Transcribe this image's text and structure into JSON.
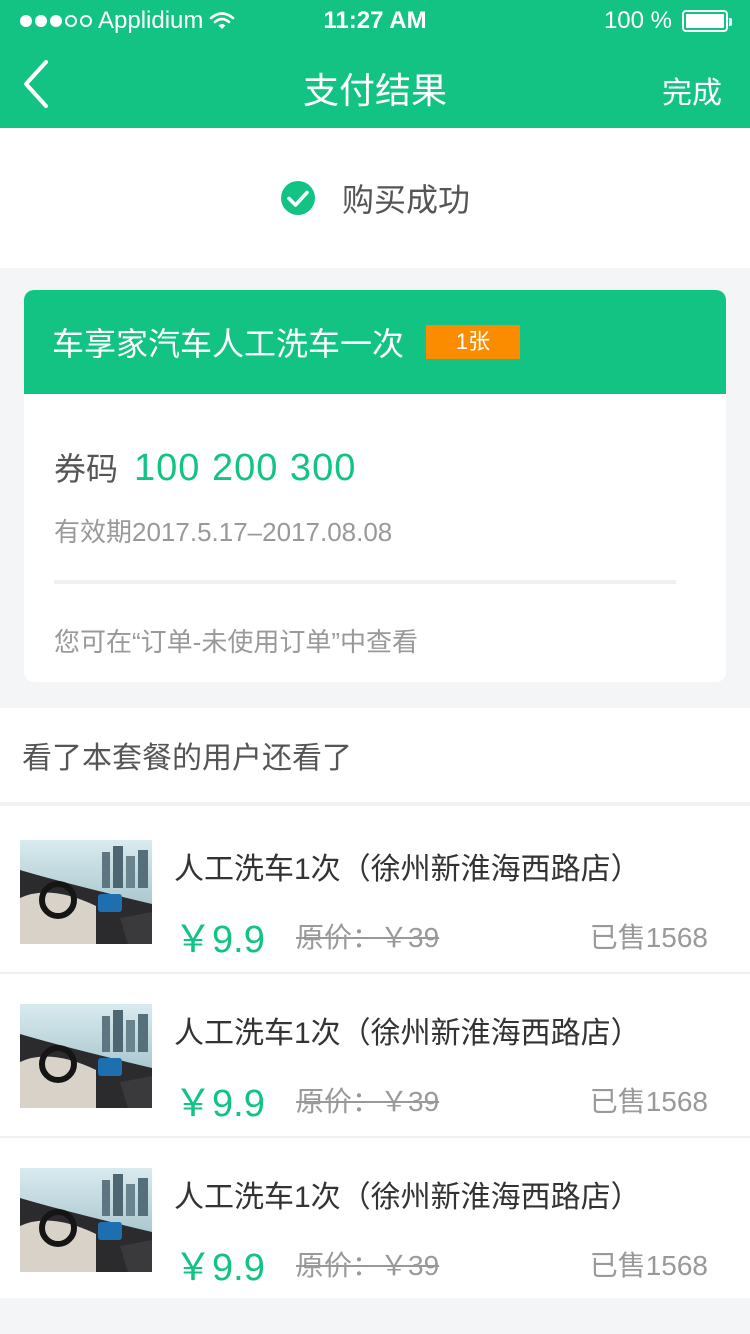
{
  "status_bar": {
    "carrier": "Applidium",
    "time": "11:27 AM",
    "battery": "100 %",
    "signal_bars": 3,
    "signal_total": 5
  },
  "nav": {
    "title": "支付结果",
    "done_label": "完成",
    "back_icon": "chevron-left-icon"
  },
  "success": {
    "text": "购买成功",
    "icon": "check-circle-icon"
  },
  "ticket": {
    "title": "车享家汽车人工洗车一次",
    "quantity": "1张",
    "code_label": "券码",
    "code_value": "100 200 300",
    "validity": "有效期2017.5.17–2017.08.08",
    "hint": "您可在“订单-未使用订单”中查看"
  },
  "recommend": {
    "heading": "看了本套餐的用户还看了",
    "items": [
      {
        "name": "人工洗车1次（徐州新淮海西路店）",
        "price": "￥9.9",
        "original_price": "原价：￥39",
        "sold": "已售1568"
      },
      {
        "name": "人工洗车1次（徐州新淮海西路店）",
        "price": "￥9.9",
        "original_price": "原价：￥39",
        "sold": "已售1568"
      },
      {
        "name": "人工洗车1次（徐州新淮海西路店）",
        "price": "￥9.9",
        "original_price": "原价：￥39",
        "sold": "已售1568"
      }
    ]
  },
  "colors": {
    "brand": "#12c384",
    "badge": "#fb8c00",
    "background": "#f4f5f7"
  }
}
